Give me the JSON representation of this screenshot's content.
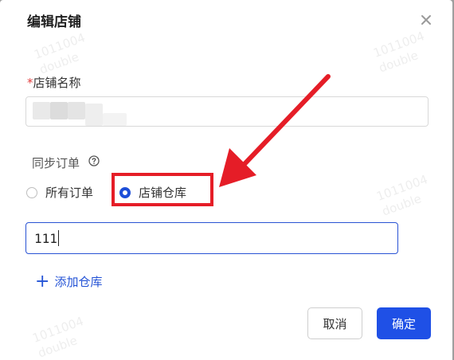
{
  "dialog": {
    "title": "编辑店铺",
    "close_icon": "close-icon"
  },
  "watermark": {
    "line1": "1011004",
    "line2": "double"
  },
  "store_name": {
    "required_mark": "*",
    "label": "店铺名称",
    "value": ""
  },
  "sync": {
    "label": "同步订单",
    "help_icon": "question-circle-icon",
    "options": [
      {
        "label": "所有订单",
        "checked": false
      },
      {
        "label": "店铺仓库",
        "checked": true
      }
    ]
  },
  "warehouse": {
    "value": "111"
  },
  "add_warehouse": {
    "icon": "plus-icon",
    "label": "添加仓库"
  },
  "footer": {
    "cancel_label": "取消",
    "ok_label": "确定"
  },
  "colors": {
    "primary": "#1f50e6",
    "annotation_red": "#e51d27",
    "required": "#e23d3d"
  }
}
